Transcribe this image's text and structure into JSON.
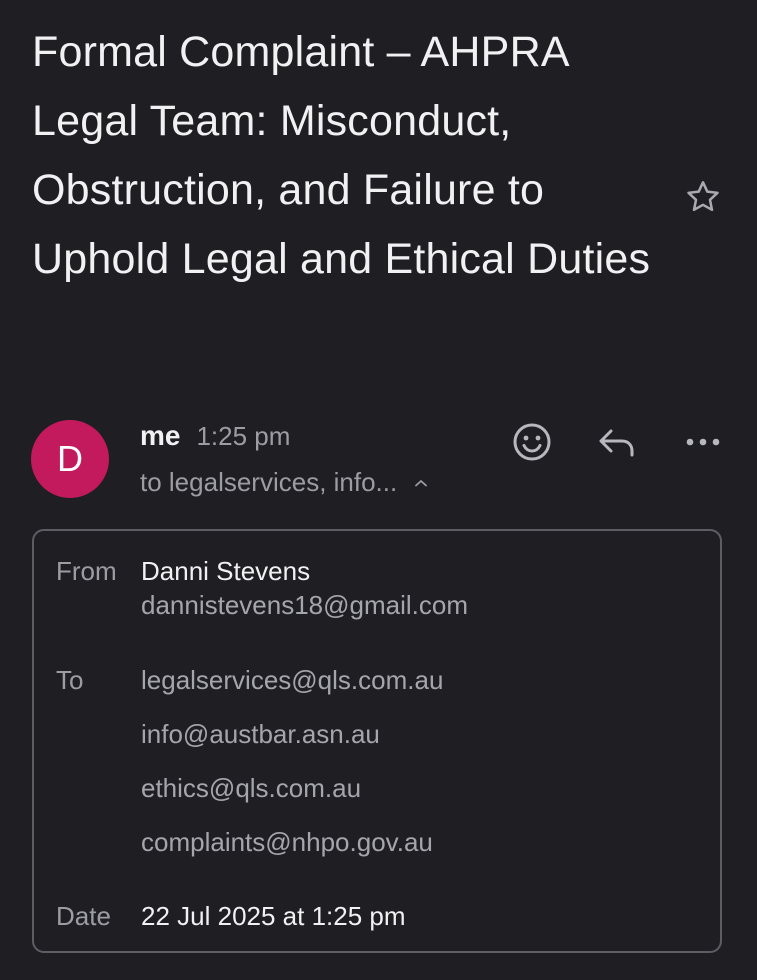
{
  "subject": "Formal Complaint – AHPRA Legal Team: Misconduct, Obstruction, and Failure to Uphold Legal and Ethical Duties",
  "header": {
    "avatar_letter": "D",
    "avatar_color": "#c3195d",
    "sender_name": "me",
    "time": "1:25 pm",
    "recipients_summary": "to legalservices, info..."
  },
  "actions": {
    "icons": [
      "star-icon",
      "emoji-reaction-icon",
      "reply-icon",
      "more-options-icon",
      "chevron-up-icon"
    ]
  },
  "details": {
    "from_label": "From",
    "from_name": "Danni Stevens",
    "from_email": "dannistevens18@gmail.com",
    "to_label": "To",
    "to": [
      "legalservices@qls.com.au",
      "info@austbar.asn.au",
      "ethics@qls.com.au",
      "complaints@nhpo.gov.au"
    ],
    "date_label": "Date",
    "date": "22 Jul 2025 at 1:25 pm"
  },
  "colors": {
    "background": "#1f1f23",
    "text_primary": "#f1f1f3",
    "text_secondary": "#9c9ca3",
    "border": "#5d5d64"
  }
}
